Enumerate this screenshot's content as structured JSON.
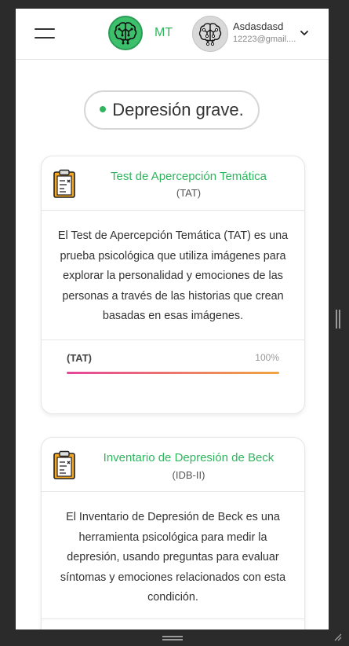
{
  "header": {
    "brand_logo_icon": "brain-network-icon",
    "brand_name": "MT",
    "user": {
      "avatar_icon": "brain-network-icon",
      "name": "Asdasdasd",
      "email": "12223@gmail...."
    },
    "menu_icon": "hamburger-menu-icon",
    "dropdown_icon": "chevron-down-icon"
  },
  "diagnosis": {
    "label": "Depresión grave.",
    "dot_color": "#2fb55e"
  },
  "tests": [
    {
      "icon": "clipboard-icon",
      "title": "Test de Apercepción Temática",
      "abbr": "(TAT)",
      "description": "El Test de Apercepción Temática (TAT) es una prueba psicológica que utiliza imágenes para explorar la personalidad y emociones de las personas a través de las historias que crean basadas en esas imágenes.",
      "progress_label": "(TAT)",
      "progress_text": "100%",
      "progress_value": 1.0
    },
    {
      "icon": "clipboard-icon",
      "title": "Inventario de Depresión de Beck",
      "abbr": "(IDB-II)",
      "description": "El Inventario de Depresión de Beck es una herramienta psicológica para medir la depresión, usando preguntas para evaluar síntomas y emociones relacionados con esta condición."
    }
  ],
  "colors": {
    "accent": "#2fb55e",
    "progress_start": "#e6459a",
    "progress_end": "#f0a640"
  }
}
